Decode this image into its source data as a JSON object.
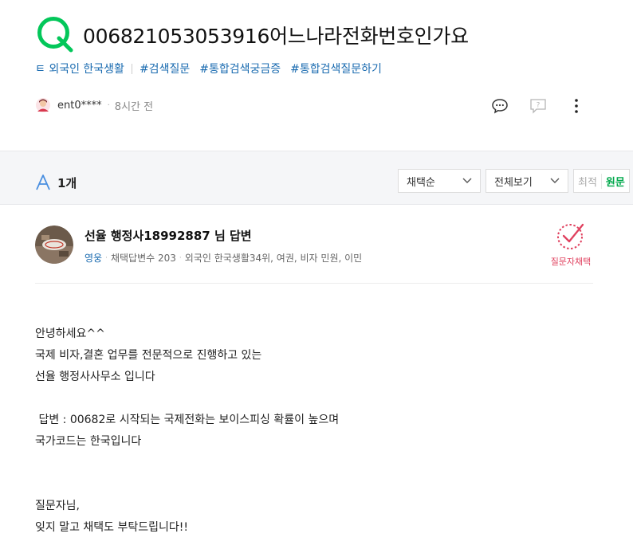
{
  "question": {
    "title": "0068210530539​16어느나라전화번호인가요",
    "author": "ent0****",
    "time": "8시간 전",
    "icons": [
      "q-logo-icon",
      "comment-icon",
      "report-question-icon",
      "more-vertical-icon"
    ]
  },
  "tags": {
    "category": "ㅌ 외국인 한국생활",
    "items": [
      "#검색질문",
      "#통합검색궁금증",
      "#통합검색질문하기"
    ]
  },
  "answers_bar": {
    "count": "1개",
    "sort": "채택순",
    "view": "전체보기",
    "lang_original": "최적",
    "lang_active": "원문"
  },
  "answer": {
    "name": "선율 행정사18992887 님 답변",
    "grade": "영웅",
    "adopt_count": "채택답변수 203",
    "rank": "외국인 한국생활34위, 여권, 비자 민원, 이민",
    "adopt_label": "질문자채택",
    "body": "안녕하세요^^\n국제 비자,결혼 업무를 전문적으로 진행하고 있는\n선율 행정사사무소 입니다\n\n 답변 : 00682로 시작되는 국제전화는 보이스피싱 확률이 높으며\n국가코드는 한국입니다\n\n\n질문자님,\n잊지 말고 채택도 부탁드립니다!!"
  },
  "colors": {
    "brand_green": "#03c75a",
    "link_blue": "#1a6bb0",
    "adopt_red": "#e0405e"
  }
}
